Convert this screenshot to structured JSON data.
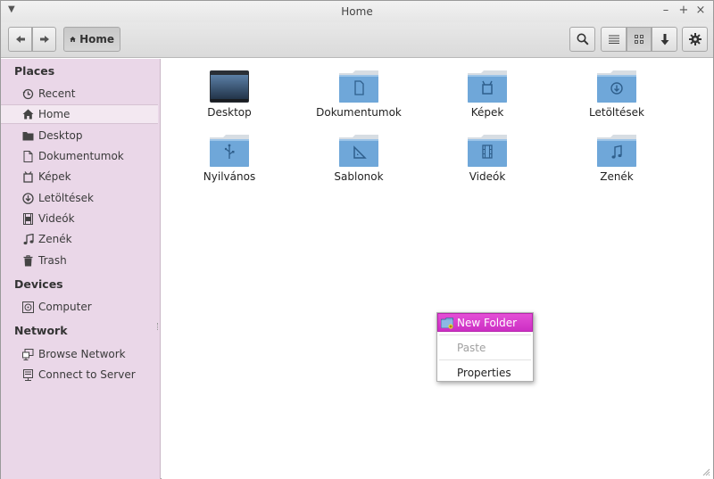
{
  "window": {
    "title": "Home"
  },
  "toolbar": {
    "breadcrumb_label": "Home"
  },
  "sidebar": {
    "sections": [
      {
        "title": "Places",
        "items": [
          {
            "label": "Recent",
            "icon": "recent-icon"
          },
          {
            "label": "Home",
            "icon": "home-icon",
            "selected": true
          },
          {
            "label": "Desktop",
            "icon": "desktop-icon"
          },
          {
            "label": "Dokumentumok",
            "icon": "document-icon"
          },
          {
            "label": "Képek",
            "icon": "pictures-icon"
          },
          {
            "label": "Letöltések",
            "icon": "download-icon"
          },
          {
            "label": "Videók",
            "icon": "video-icon"
          },
          {
            "label": "Zenék",
            "icon": "music-icon"
          },
          {
            "label": "Trash",
            "icon": "trash-icon"
          }
        ]
      },
      {
        "title": "Devices",
        "items": [
          {
            "label": "Computer",
            "icon": "computer-icon"
          }
        ]
      },
      {
        "title": "Network",
        "items": [
          {
            "label": "Browse Network",
            "icon": "network-icon"
          },
          {
            "label": "Connect to Server",
            "icon": "server-icon"
          }
        ]
      }
    ]
  },
  "files": [
    {
      "label": "Desktop",
      "icon": "desktop-folder-icon"
    },
    {
      "label": "Dokumentumok",
      "icon": "documents-folder-icon"
    },
    {
      "label": "Képek",
      "icon": "pictures-folder-icon"
    },
    {
      "label": "Letöltések",
      "icon": "downloads-folder-icon"
    },
    {
      "label": "Nyilvános",
      "icon": "public-folder-icon"
    },
    {
      "label": "Sablonok",
      "icon": "templates-folder-icon"
    },
    {
      "label": "Videók",
      "icon": "videos-folder-icon"
    },
    {
      "label": "Zenék",
      "icon": "music-folder-icon"
    }
  ],
  "context_menu": {
    "items": [
      {
        "label": "New Folder",
        "highlighted": true
      },
      {
        "label": "Paste",
        "disabled": true
      },
      {
        "label": "Properties"
      }
    ]
  },
  "colors": {
    "sidebar_bg": "#ead7e8",
    "accent": "#d835cd",
    "folder_blue": "#6fa7d9"
  }
}
